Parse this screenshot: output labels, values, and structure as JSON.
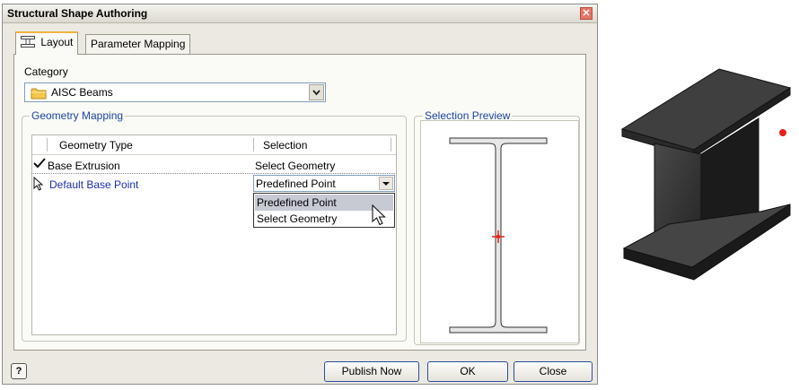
{
  "dialog": {
    "title": "Structural Shape Authoring",
    "close_glyph": "✕"
  },
  "tabs": [
    {
      "label": "Layout",
      "icon": "layout-icon",
      "active": true
    },
    {
      "label": "Parameter Mapping",
      "active": false
    }
  ],
  "category": {
    "label": "Category",
    "value": "AISC Beams",
    "icon": "folder-icon"
  },
  "geometry_mapping": {
    "title": "Geometry Mapping",
    "columns": [
      "Geometry Type",
      "Selection"
    ],
    "rows": [
      {
        "geometry_type": "Base Extrusion",
        "selection": "Select Geometry",
        "status": "check-icon"
      },
      {
        "geometry_type": "Default Base Point",
        "selection": "Predefined Point",
        "status": "pointer-icon"
      }
    ],
    "dropdown_options": [
      "Predefined Point",
      "Select Geometry"
    ],
    "highlighted_option": "Predefined Point"
  },
  "selection_preview": {
    "title": "Selection Preview",
    "marker_color": "#e8221b"
  },
  "buttons": {
    "help": "?",
    "publish": "Publish Now",
    "ok": "OK",
    "close": "Close"
  },
  "colors": {
    "group_title": "#1c46a0",
    "active_tab_accent": "#f2b441",
    "row_link": "#1c2fb0"
  }
}
